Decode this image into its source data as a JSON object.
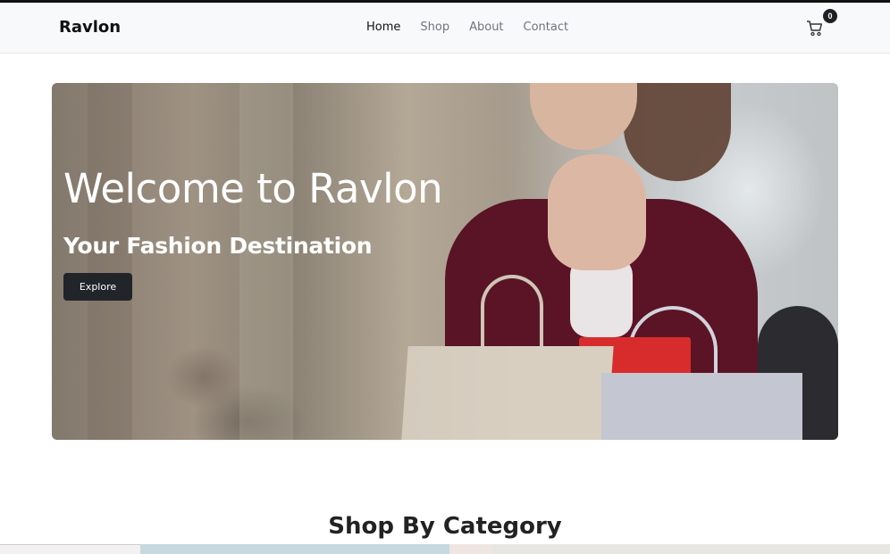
{
  "header": {
    "brand": "Ravlon",
    "nav": [
      {
        "label": "Home",
        "active": true
      },
      {
        "label": "Shop",
        "active": false
      },
      {
        "label": "About",
        "active": false
      },
      {
        "label": "Contact",
        "active": false
      }
    ],
    "cart": {
      "icon": "cart-icon",
      "count": "0"
    }
  },
  "hero": {
    "title": "Welcome to Ravlon",
    "subtitle": "Your Fashion Destination",
    "button_label": "Explore"
  },
  "sections": {
    "category_title": "Shop By Category"
  },
  "colors": {
    "dark": "#212529",
    "navbar_bg": "#f8f9fa",
    "muted_link": "#6c757d"
  }
}
